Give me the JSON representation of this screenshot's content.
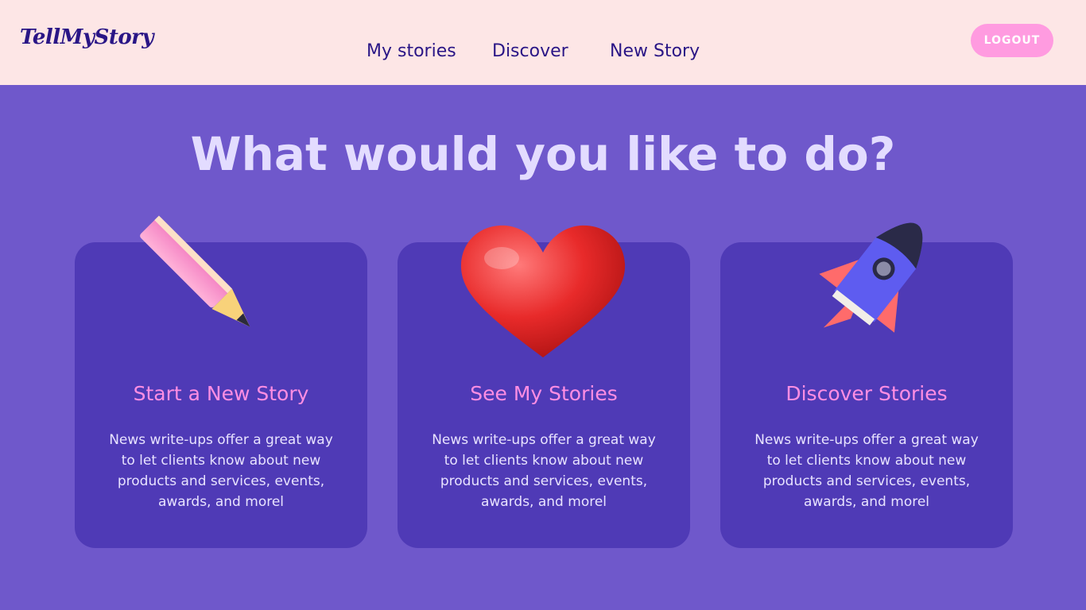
{
  "header": {
    "logo": "TellMyStory",
    "nav": [
      {
        "label": "My stories"
      },
      {
        "label": "Discover"
      },
      {
        "label": "New Story"
      }
    ],
    "logout_label": "LOGOUT"
  },
  "main": {
    "title": "What would you like to do?",
    "cards": [
      {
        "title": "Start a New Story",
        "body": "News write-ups offer a great way to let clients know about new products and services, events, awards, and morel",
        "icon": "pencil-icon"
      },
      {
        "title": "See My Stories",
        "body": "News write-ups offer a great way to let clients know about new products and services, events, awards, and morel",
        "icon": "heart-icon"
      },
      {
        "title": "Discover Stories",
        "body": "News write-ups offer a great way to let clients know about new products and services, events, awards, and morel",
        "icon": "rocket-icon"
      }
    ]
  },
  "colors": {
    "background": "#6f58cb",
    "header": "#fde6e6",
    "card": "#4f3ab6",
    "accent_pink": "#ff8ee3",
    "brand": "#2a1686"
  }
}
